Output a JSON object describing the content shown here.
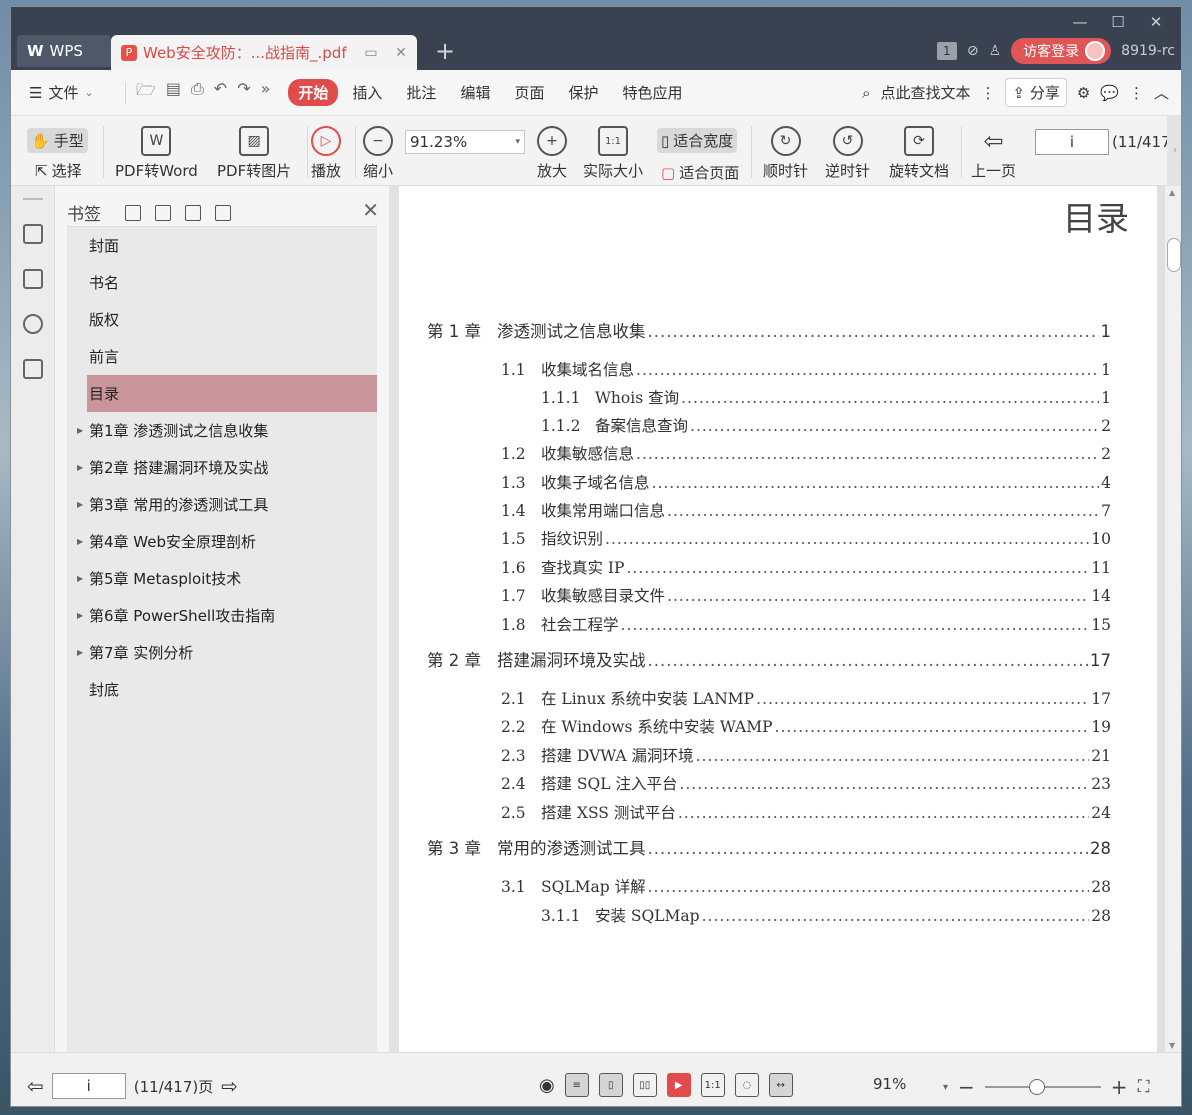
{
  "titlebar": {
    "wps_tab": "WPS",
    "doc_tab_title": "Web安全攻防：...战指南_.pdf",
    "badge": "1",
    "login": "访客登录",
    "version": "8919-rc",
    "controls": {
      "minimize": "—",
      "maximize": "☐",
      "close": "✕"
    }
  },
  "menubar": {
    "file": "文件",
    "items": [
      "开始",
      "插入",
      "批注",
      "编辑",
      "页面",
      "保护",
      "特色应用"
    ],
    "active": "开始",
    "search": "点此查找文本",
    "share": "分享"
  },
  "toolbar": {
    "hand": "手型",
    "select": "选择",
    "pdf_to_word": "PDF转Word",
    "pdf_to_image": "PDF转图片",
    "play": "播放",
    "zoom_out": "缩小",
    "zoom_value": "91.23%",
    "zoom_in": "放大",
    "actual_size": "实际大小",
    "fit_width": "适合宽度",
    "fit_page": "适合页面",
    "clockwise": "顺时针",
    "counter_clockwise": "逆时针",
    "rotate_doc": "旋转文档",
    "prev_page": "上一页",
    "page_value": "i",
    "page_of": "(11/417"
  },
  "bookmarks": {
    "title": "书签",
    "items": [
      {
        "label": "封面",
        "expandable": false
      },
      {
        "label": "书名",
        "expandable": false
      },
      {
        "label": "版权",
        "expandable": false
      },
      {
        "label": "前言",
        "expandable": false
      },
      {
        "label": "目录",
        "expandable": false,
        "selected": true
      },
      {
        "label": "第1章  渗透测试之信息收集",
        "expandable": true
      },
      {
        "label": "第2章  搭建漏洞环境及实战",
        "expandable": true
      },
      {
        "label": "第3章  常用的渗透测试工具",
        "expandable": true
      },
      {
        "label": "第4章  Web安全原理剖析",
        "expandable": true
      },
      {
        "label": "第5章  Metasploit技术",
        "expandable": true
      },
      {
        "label": "第6章  PowerShell攻击指南",
        "expandable": true
      },
      {
        "label": "第7章  实例分析",
        "expandable": true
      },
      {
        "label": "封底",
        "expandable": false
      }
    ]
  },
  "document": {
    "heading": "目录",
    "toc": [
      {
        "level": 0,
        "num": "第 1 章",
        "title": "渗透测试之信息收集",
        "page": "1"
      },
      {
        "level": 1,
        "num": "1.1",
        "title": "收集域名信息",
        "page": "1"
      },
      {
        "level": 2,
        "num": "1.1.1",
        "title": "Whois 查询",
        "page": "1"
      },
      {
        "level": 2,
        "num": "1.1.2",
        "title": "备案信息查询",
        "page": "2"
      },
      {
        "level": 1,
        "num": "1.2",
        "title": "收集敏感信息",
        "page": "2"
      },
      {
        "level": 1,
        "num": "1.3",
        "title": "收集子域名信息",
        "page": "4"
      },
      {
        "level": 1,
        "num": "1.4",
        "title": "收集常用端口信息",
        "page": "7"
      },
      {
        "level": 1,
        "num": "1.5",
        "title": "指纹识别",
        "page": "10"
      },
      {
        "level": 1,
        "num": "1.6",
        "title": "查找真实 IP",
        "page": "11"
      },
      {
        "level": 1,
        "num": "1.7",
        "title": "收集敏感目录文件",
        "page": "14"
      },
      {
        "level": 1,
        "num": "1.8",
        "title": "社会工程学",
        "page": "15"
      },
      {
        "level": 0,
        "num": "第 2 章",
        "title": "搭建漏洞环境及实战",
        "page": "17"
      },
      {
        "level": 1,
        "num": "2.1",
        "title": "在 Linux 系统中安装 LANMP",
        "page": "17"
      },
      {
        "level": 1,
        "num": "2.2",
        "title": "在 Windows 系统中安装 WAMP",
        "page": "19"
      },
      {
        "level": 1,
        "num": "2.3",
        "title": "搭建 DVWA 漏洞环境",
        "page": "21"
      },
      {
        "level": 1,
        "num": "2.4",
        "title": "搭建 SQL 注入平台",
        "page": "23"
      },
      {
        "level": 1,
        "num": "2.5",
        "title": "搭建 XSS 测试平台",
        "page": "24"
      },
      {
        "level": 0,
        "num": "第 3 章",
        "title": "常用的渗透测试工具",
        "page": "28"
      },
      {
        "level": 1,
        "num": "3.1",
        "title": "SQLMap 详解",
        "page": "28"
      },
      {
        "level": 2,
        "num": "3.1.1",
        "title": "安装 SQLMap",
        "page": "28"
      }
    ]
  },
  "statusbar": {
    "page_value": "i",
    "page_of": "(11/417)页",
    "zoom": "91%",
    "zoom_level": 0.45
  }
}
